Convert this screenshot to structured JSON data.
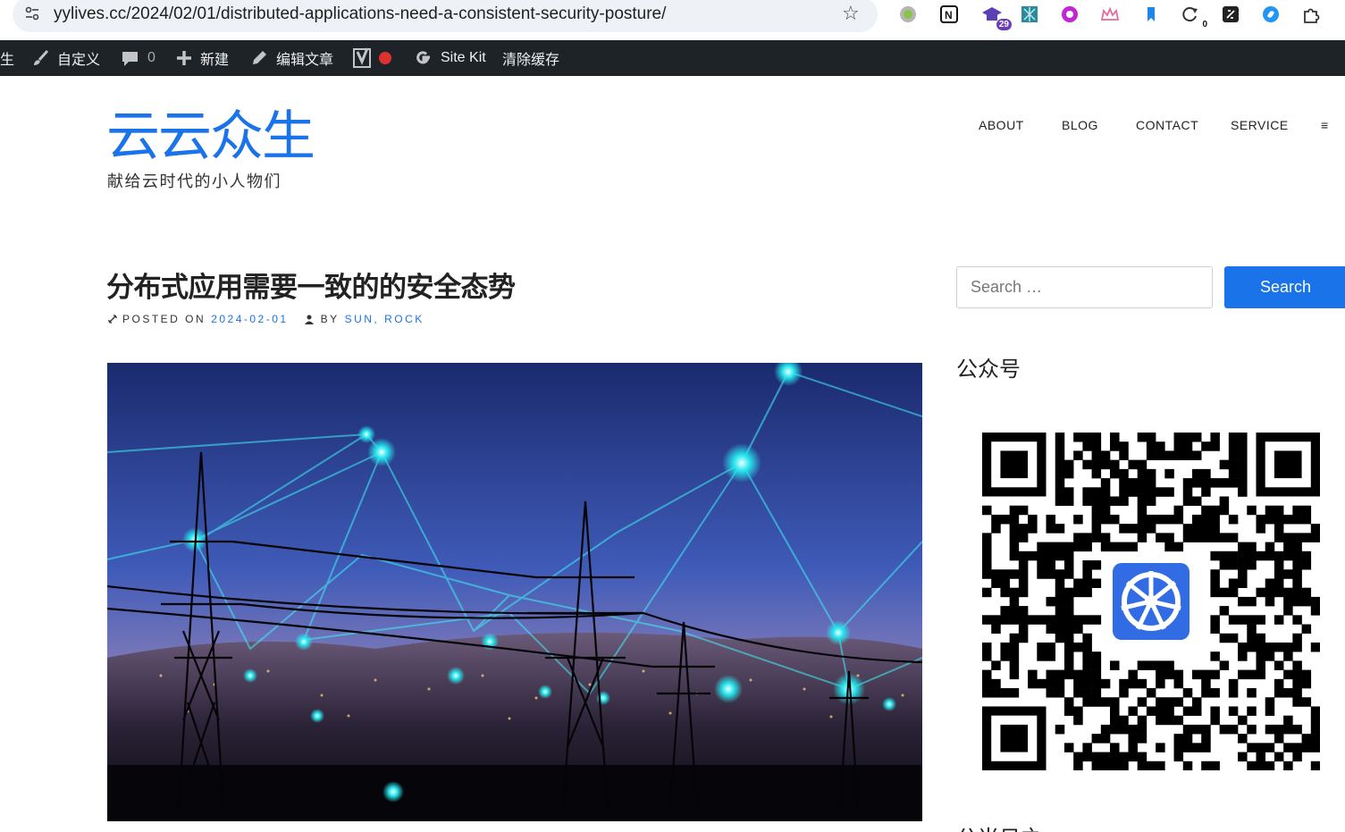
{
  "browser": {
    "url": "yylives.cc/2024/02/01/distributed-applications-need-a-consistent-security-posture/",
    "extensions": [
      {
        "name": "gray-circle-extension-icon",
        "color": "#9aa0a6"
      },
      {
        "name": "notion-icon",
        "label": "N"
      },
      {
        "name": "graduation-cap-extension-icon",
        "badge": "29"
      },
      {
        "name": "grid-extension-icon"
      },
      {
        "name": "purple-circle-extension-icon"
      },
      {
        "name": "crown-extension-icon"
      },
      {
        "name": "blue-bookmark-extension-icon"
      },
      {
        "name": "refresh-extension-icon",
        "badge": "0"
      },
      {
        "name": "dark-square-extension-icon"
      },
      {
        "name": "blue-swirl-extension-icon"
      },
      {
        "name": "puzzle-extensions-icon"
      }
    ]
  },
  "adminbar": {
    "site_partial": "生",
    "customize": "自定义",
    "comments_count": "0",
    "new": "新建",
    "edit_post": "编辑文章",
    "sitekit": "Site Kit",
    "clear_cache": "清除缓存"
  },
  "site": {
    "title": "云云众生",
    "description": "献给云时代的小人物们",
    "nav": [
      "ABOUT",
      "BLOG",
      "CONTACT",
      "SERVICE"
    ],
    "menu_toggle": "≡"
  },
  "post": {
    "title": "分布式应用需要一致的的安全态势",
    "posted_on_label": "POSTED ON",
    "date": "2024-02-01",
    "by_label": "BY",
    "authors": "SUN, ROCK"
  },
  "sidebar": {
    "search_placeholder": "Search …",
    "search_button": "Search",
    "widget_title": "公众号",
    "widget_title_2": "公当日之"
  },
  "colors": {
    "accent": "#1a73e8",
    "adminbar": "#1d2327"
  }
}
